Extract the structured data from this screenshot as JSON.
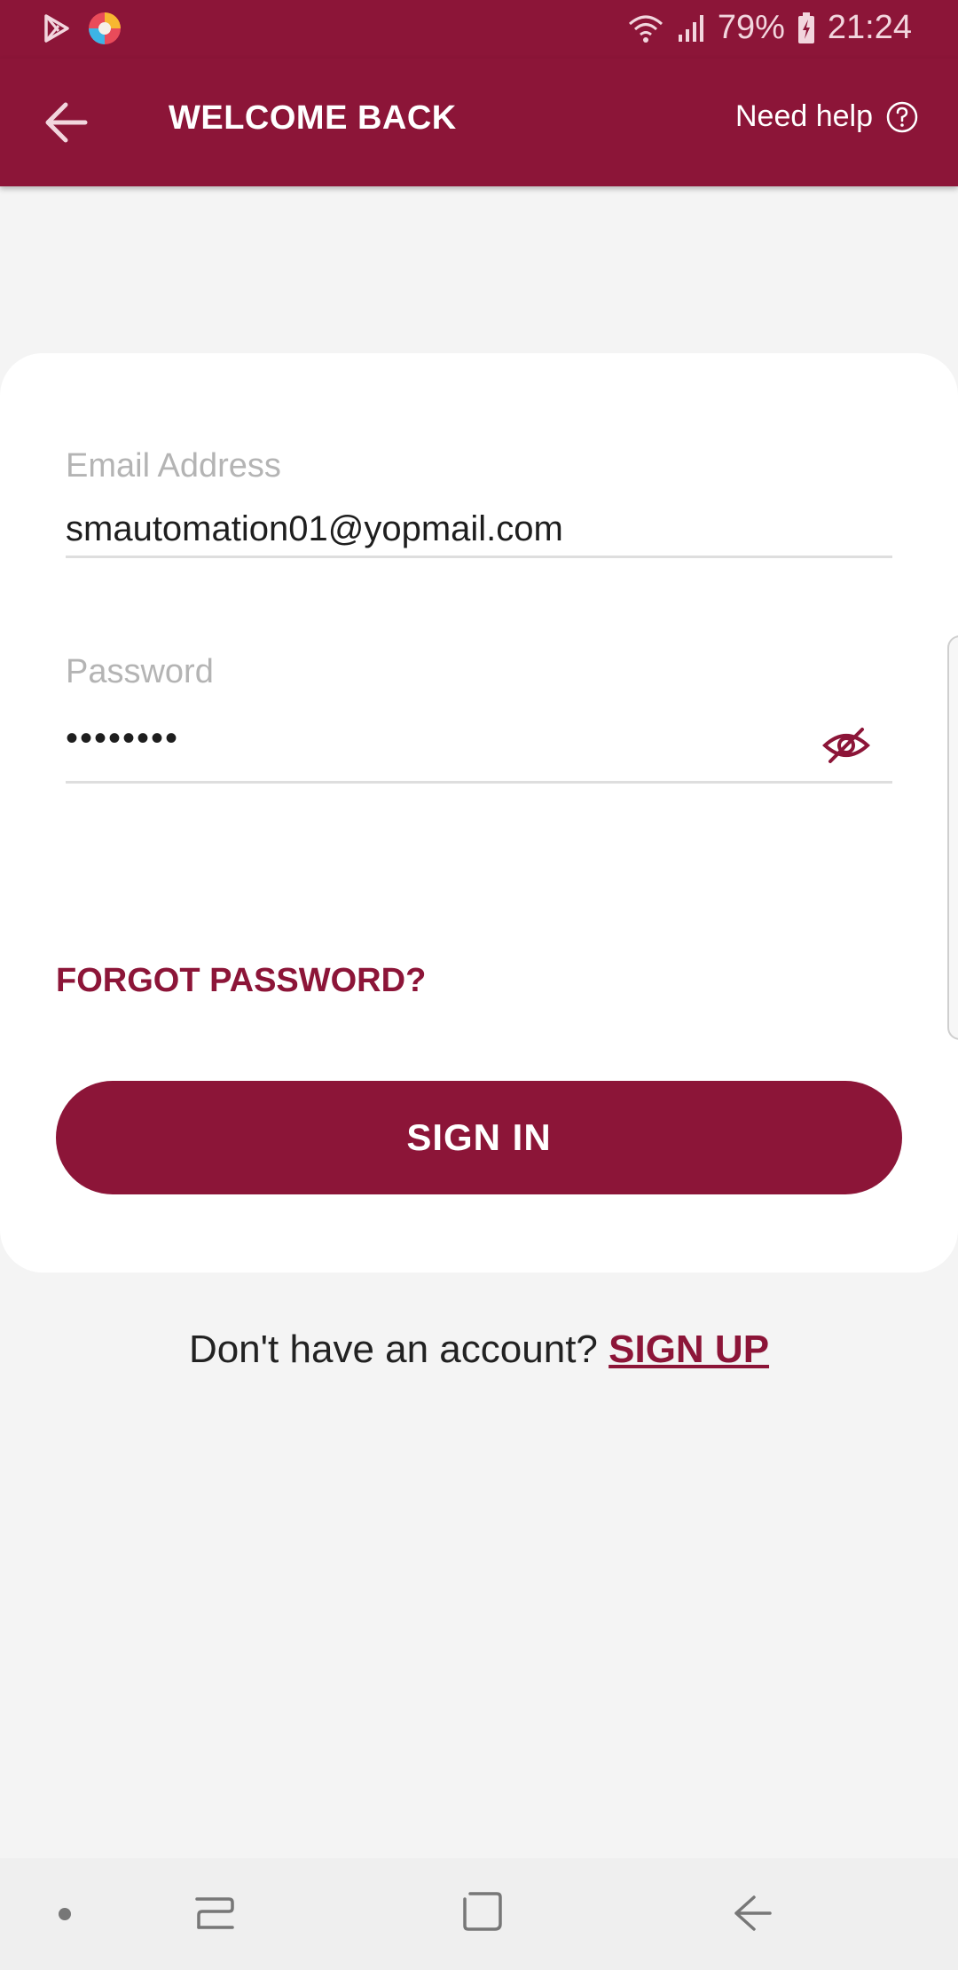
{
  "colors": {
    "brand": "#8c1538",
    "background": "#f4f4f4",
    "card": "#ffffff",
    "label_grey": "#b4b4b4"
  },
  "status_bar": {
    "battery": "79%",
    "time": "21:24",
    "icons": [
      "play-store-icon",
      "browser-app-icon",
      "wifi-icon",
      "signal-icon",
      "battery-charging-icon"
    ]
  },
  "app_bar": {
    "title": "WELCOME BACK",
    "help_label": "Need help",
    "icons": [
      "back-arrow-icon",
      "help-circle-icon"
    ]
  },
  "login_form": {
    "email": {
      "label": "Email Address",
      "value": "smautomation01@yopmail.com"
    },
    "password": {
      "label": "Password",
      "value": "••••••••",
      "toggle_icon": "eye-slash-icon"
    },
    "forgot_password": "FORGOT PASSWORD?",
    "sign_in": "SIGN IN"
  },
  "signup_prompt": {
    "text": "Don't have an account?",
    "link": "SIGN UP"
  },
  "nav_bar": {
    "icons": [
      "nav-dot-icon",
      "recent-apps-icon",
      "home-icon",
      "back-icon"
    ]
  }
}
